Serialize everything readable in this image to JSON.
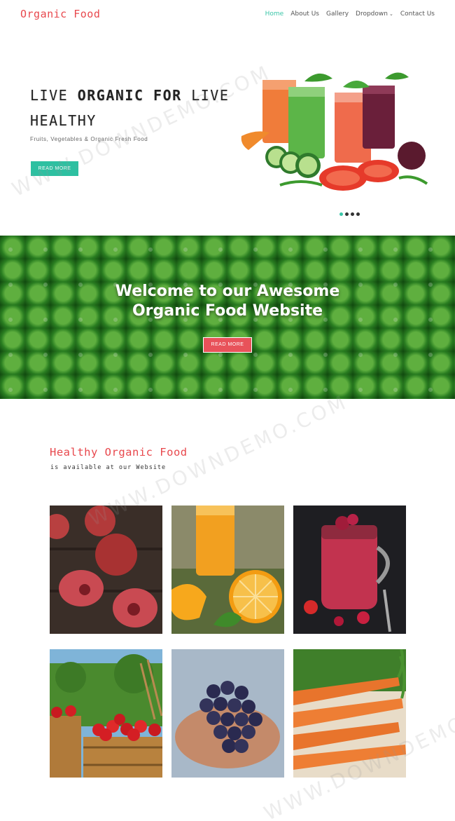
{
  "header": {
    "brand": "Organic Food",
    "nav": [
      {
        "label": "Home",
        "active": true
      },
      {
        "label": "About Us",
        "active": false
      },
      {
        "label": "Gallery",
        "active": false
      },
      {
        "label": "Dropdown",
        "active": false,
        "has_caret": true
      },
      {
        "label": "Contact Us",
        "active": false
      }
    ]
  },
  "hero": {
    "title_line1_regular": "LIVE ",
    "title_line1_bold": "ORGANIC FOR",
    "title_line1_tail": " LIVE",
    "title_line2": "HEALTHY",
    "subtitle": "Fruits, Vegetables & Organic Fresh Food",
    "button": "READ MORE",
    "slides": 4,
    "active_slide": 1,
    "image_icon": "juice-glasses-image"
  },
  "banner": {
    "title_line1": "Welcome to our Awesome",
    "title_line2": "Organic Food Website",
    "button": "READ MORE",
    "image_icon": "green-peas-background"
  },
  "section": {
    "title": "Healthy Organic Food",
    "subtitle": "is available at our Website"
  },
  "gallery": [
    {
      "name": "plums-image"
    },
    {
      "name": "orange-juice-image"
    },
    {
      "name": "berry-smoothie-jar-image"
    },
    {
      "name": "apple-orchard-barrels-image"
    },
    {
      "name": "grapes-in-hands-image"
    },
    {
      "name": "carrots-image"
    }
  ],
  "watermark": "WWW.DOWNDEMO.COM",
  "colors": {
    "brand": "#e8484d",
    "accent_teal": "#2dc0a1",
    "banner_button": "#e8525a"
  }
}
